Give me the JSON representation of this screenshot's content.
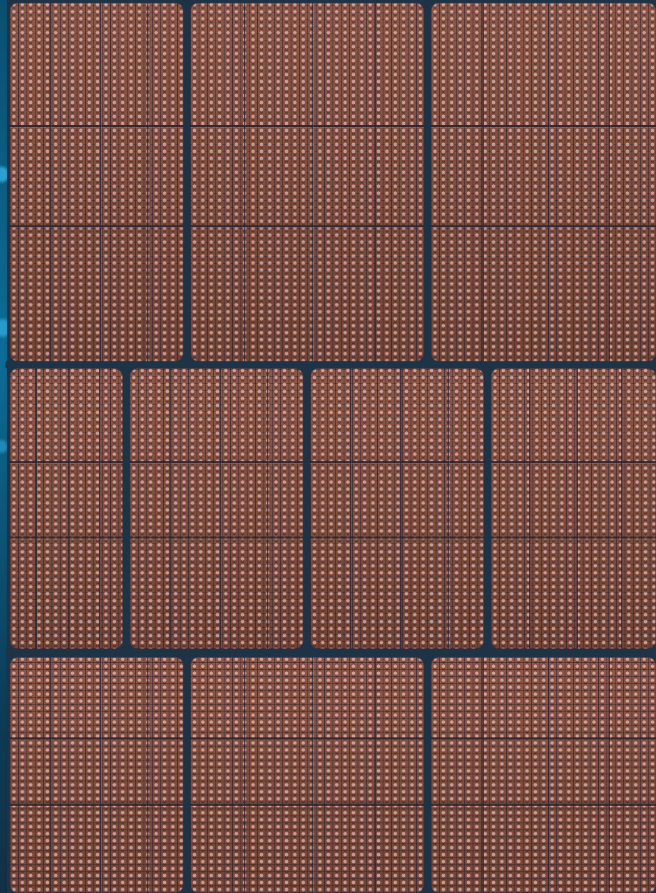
{
  "screen": {
    "background_color": "#1f3346",
    "accent_color": "#0f5f86",
    "tile_color": "#7b4b38"
  },
  "tiles": [
    {
      "name": "top-left-tile"
    },
    {
      "name": "top-middle-tile"
    },
    {
      "name": "top-right-tile"
    },
    {
      "name": "middle-first-tile"
    },
    {
      "name": "middle-second-tile"
    },
    {
      "name": "middle-third-tile"
    },
    {
      "name": "middle-fourth-tile"
    },
    {
      "name": "bottom-left-tile"
    },
    {
      "name": "bottom-middle-tile"
    },
    {
      "name": "bottom-right-tile"
    }
  ]
}
